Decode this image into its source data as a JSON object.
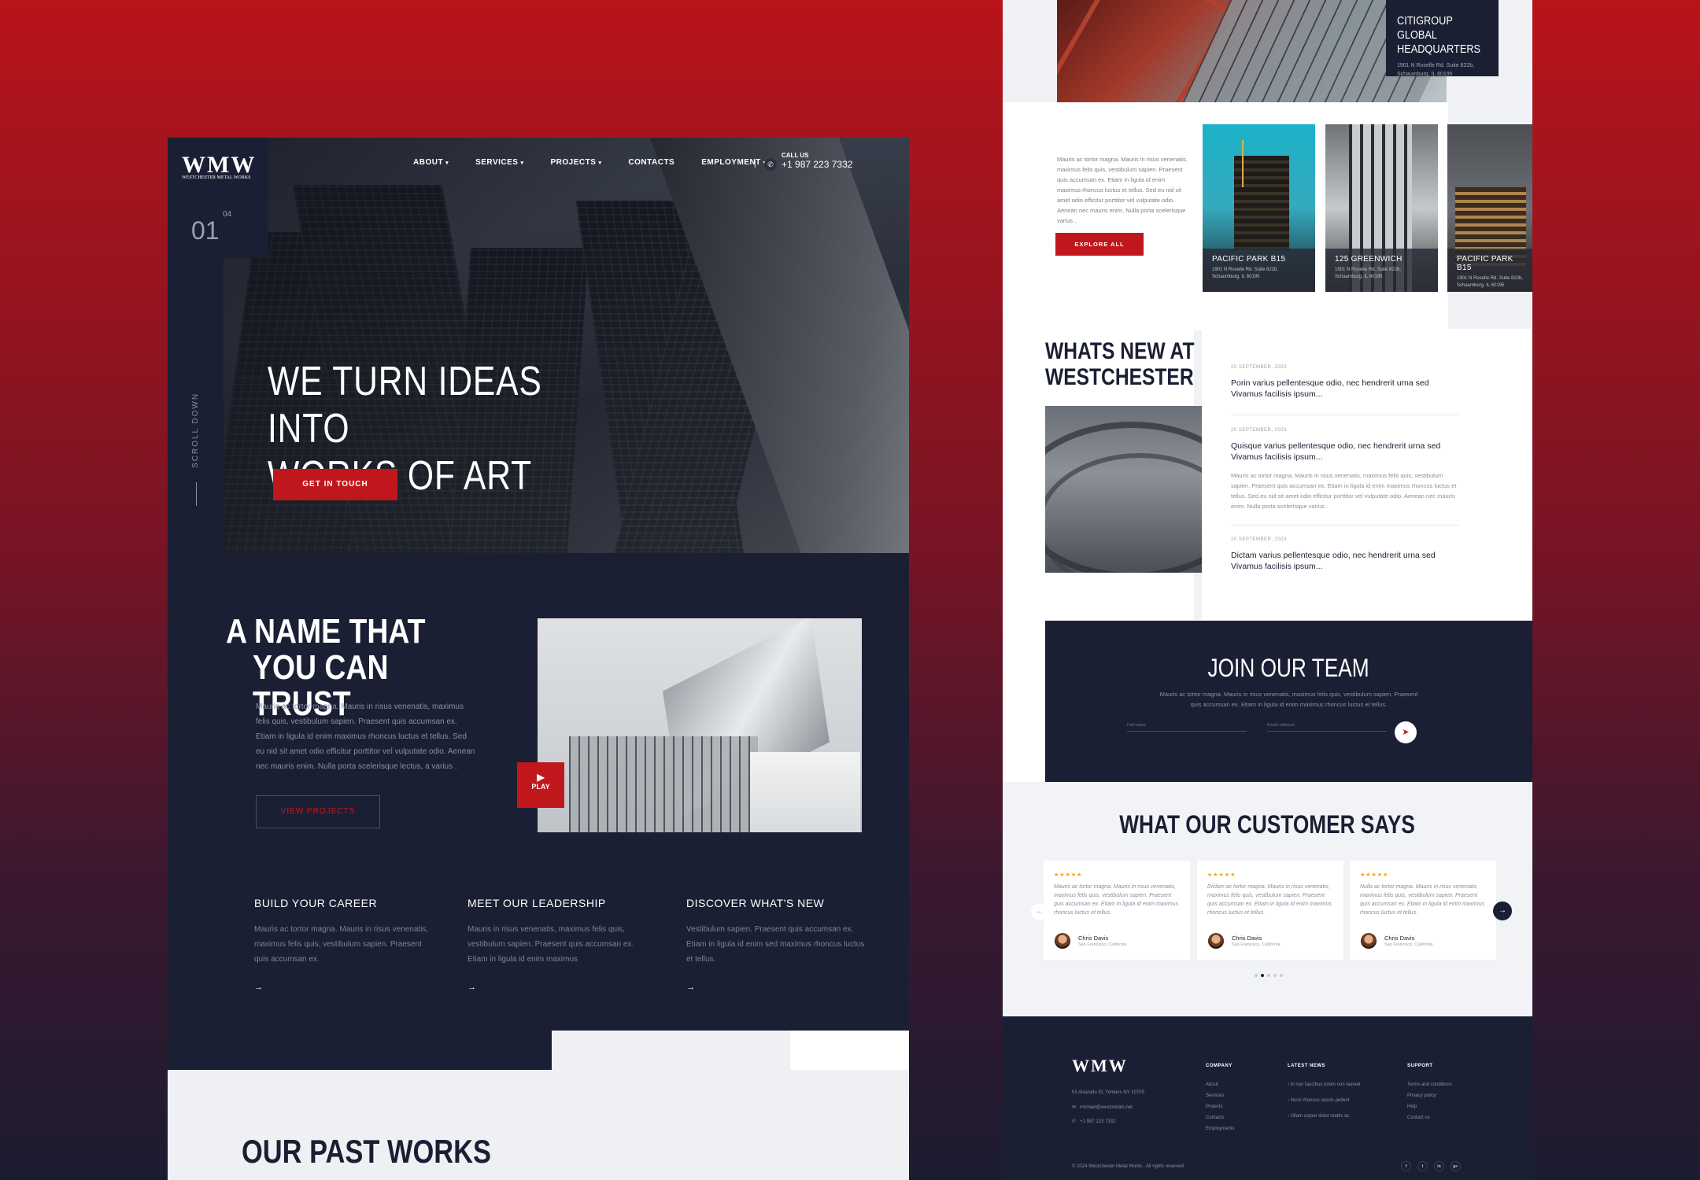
{
  "left": {
    "logo": {
      "text": "WMW",
      "tagline": "WESTCHESTER METAL WORKS"
    },
    "counter": {
      "current": "01",
      "total": "04"
    },
    "scroll_label": "SCROLL DOWN",
    "nav": [
      {
        "label": "ABOUT",
        "caret": true
      },
      {
        "label": "SERVICES",
        "caret": true
      },
      {
        "label": "PROJECTS",
        "caret": true
      },
      {
        "label": "CONTACTS",
        "caret": false
      },
      {
        "label": "EMPLOYMENT",
        "caret": true
      }
    ],
    "nav_separator": "|",
    "call": {
      "label": "CALL US",
      "number": "+1 987 223 7332"
    },
    "hero": {
      "title_line1": "WE TURN IDEAS INTO",
      "title_line2": "WORKS OF ART",
      "cta": "GET IN TOUCH"
    },
    "trust": {
      "title_line1": "A NAME THAT",
      "title_line2": "YOU CAN TRUST",
      "body": "Mauris ac tortor magna. Mauris in risus venenatis, maximus felis quis, vestibulum sapien. Praesent quis accumsan ex. Etiam in ligula id enim maximus rhoncus luctus et tellus.  Sed eu nid sit amet odio efficitur porttitor vel vulputate odio. Aenean nec mauris enim. Nulla porta scelerisque lectus, a varius .",
      "button": "VIEW PROJECTS",
      "play": "PLAY"
    },
    "cards": [
      {
        "title": "BUILD YOUR CAREER",
        "body": "Mauris ac tortor magna. Mauris in risus venenatis, maximus felis quis, vestibulum sapien. Praesent quis accumsan ex.",
        "arrow": "→"
      },
      {
        "title": "MEET OUR LEADERSHIP",
        "body": "Mauris in risus venenatis, maximus felis quis, vestibulum sapien. Praesent quis accumsan ex. Etiam in ligula id enim maximus",
        "arrow": "→"
      },
      {
        "title": "DISCOVER WHAT'S NEW",
        "body": "Vestibulum sapien. Praesent quis accumsan ex. Etiam in ligula id enim sed maximus rhoncus luctus et tellus.",
        "arrow": "→"
      }
    ],
    "past_works_title": "OUR PAST WORKS"
  },
  "right": {
    "featured": {
      "title": "CITIGROUP GLOBAL HEADQUARTERS",
      "address": "1901 N Roselle Rd. Suite 822b, Schaumburg, IL 60195"
    },
    "intro_body": "Mauris ac tortor magna. Mauris in risus venenatis, maximus felis quis, vestibulum sapien. Praesent quis accumsan ex. Etiam in ligula id enim maximus rhoncus luctus et tellus.  Sed eu nid sit amet odio efficitur porttitor vel vulputate odio. Aenean nec mauris enim. Nulla porta scelerisque varius .",
    "explore": "EXPLORE ALL",
    "projects": [
      {
        "title": "PACIFIC PARK B15",
        "address": "1901 N Roselle Rd. Suite 822b, Schaumburg, IL 60195"
      },
      {
        "title": "125 GREENWICH",
        "address": "1901 N Roselle Rd. Suite 822b, Schaumburg, IL 60195"
      },
      {
        "title": "PACIFIC PARK B15",
        "address": "1901 N Roselle Rd. Suite 822b, Schaumburg, IL 60195"
      }
    ],
    "news": {
      "title_line1": "WHATS NEW AT",
      "title_line2": "WESTCHESTER",
      "items": [
        {
          "date": "20 SEPTEMBER, 2023",
          "title": "Porin varius pellentesque odio, nec hendrerit urna sed Vivamus facilisis ipsum...",
          "body": ""
        },
        {
          "date": "20 SEPTEMBER, 2023",
          "title": "Quisque varius pellentesque odio, nec hendrerit urna sed Vivamus facilisis ipsum...",
          "body": "Mauris ac tortor magna. Mauris in risus venenatis, maximus felis quis, vestibulum sapien. Praesent quis accumsan ex. Etiam in ligula id enim maximus rhoncus luctus et tellus.  Sed eu nid sit amet odio efficitur porttitor vel vulputate odio. Aenean nec mauris enim. Nulla porta scelerisque varius ."
        },
        {
          "date": "20 SEPTEMBER, 2023",
          "title": "Dictam varius pellentesque odio, nec hendrerit urna sed Vivamus facilisis ipsum...",
          "body": ""
        }
      ]
    },
    "join": {
      "title": "JOIN OUR TEAM",
      "body": "Mauris ac tortor magna. Mauris in risus venenatis, maximus felis quis, vestibulum sapien. Praesent quis accumsan ex. Etiam in ligula id enim maximus rhoncus luctus et tellus.",
      "name_placeholder": "Full name",
      "email_placeholder": "Email address",
      "send_icon": "paper-plane-icon"
    },
    "testimonials": {
      "title": "WHAT OUR CUSTOMER SAYS",
      "items": [
        {
          "stars": "★★★★★",
          "text": "Mauris ac tortor magna. Mauris in risus venenatis, maximus felis quis, vestibulum sapien. Praesent quis accumsan ex. Etiam in ligula id enim maximus rhoncus luctus et tellus.",
          "name": "Chris Davis",
          "location": "San Francisco, California"
        },
        {
          "stars": "★★★★★",
          "text": "Dictam ac tortor magna. Mauris in risus venenatis, maximus felis quis, vestibulum sapien. Praesent quis accumsan ex. Etiam in ligula id enim maximus rhoncus luctus et tellus.",
          "name": "Chris Davis",
          "location": "San Francisco, California"
        },
        {
          "stars": "★★★★★",
          "text": "Nulla ac tortor magna. Mauris in risus venenatis, maximus felis quis, vestibulum sapien. Praesent quis accumsan ex. Etiam in ligula id enim maximus rhoncus luctus et tellus.",
          "name": "Chris Davis",
          "location": "San Francisco, California"
        }
      ],
      "prev": "←",
      "next": "→"
    },
    "footer": {
      "logo": "WMW",
      "address": "53 Alvarado St, Yonkers NY 10705",
      "email": "michael@westmetals.net",
      "phone": "+1 987 223 7332",
      "company": {
        "title": "COMPANY",
        "links": [
          "About",
          "Services",
          "Projects",
          "Contacts",
          "Employments"
        ]
      },
      "latest_news": {
        "title": "LATEST NEWS",
        "links": [
          "In non faucibus lorem non laoreet",
          "Nunc rhoncus iaculis pellent",
          "Ullam corper dolor mattis ac"
        ]
      },
      "support": {
        "title": "SUPPORT",
        "links": [
          "Terms and conditions",
          "Privacy policy",
          "Help",
          "Contact us"
        ]
      },
      "copyright": "© 2024 Westchester Metal Works . All rights reserved",
      "social": [
        "f",
        "t",
        "in",
        "g+"
      ]
    }
  },
  "colors": {
    "accent": "#c0171d",
    "navy": "#1b1f33",
    "light": "#eef0f4"
  }
}
